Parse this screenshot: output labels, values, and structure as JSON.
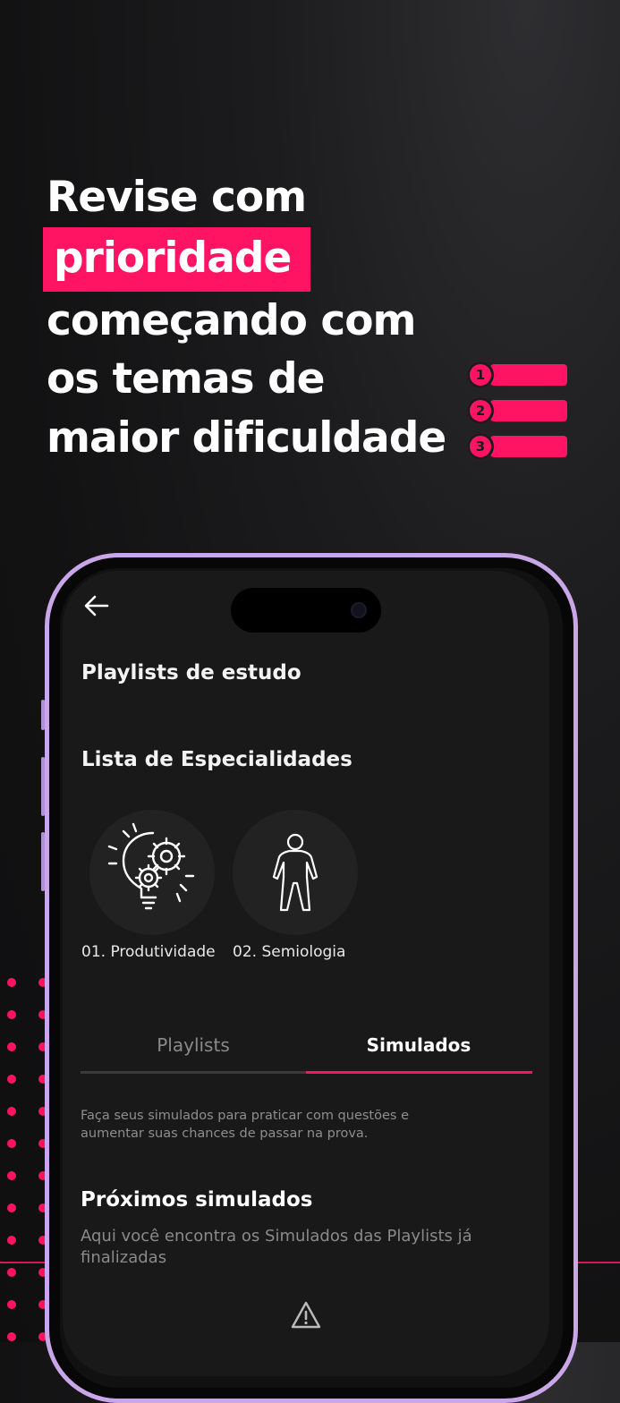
{
  "headline": {
    "line1": "Revise com",
    "highlight": "prioridade",
    "line3": "começando com",
    "line4": "os temas de",
    "line5": "maior dificuldade"
  },
  "ranking": [
    "1",
    "2",
    "3"
  ],
  "colors": {
    "accent": "#ff1464",
    "background": "#121213",
    "phone_frame": "#c9a6e8",
    "screen": "#191919"
  },
  "app": {
    "back_icon": "arrow-left-icon",
    "page_title": "Playlists de estudo",
    "section_title": "Lista de Especialidades",
    "specialties": [
      {
        "label": "01. Produtividade",
        "icon": "lightbulb-gears-icon"
      },
      {
        "label": "02. Semiologia",
        "icon": "human-body-icon"
      }
    ],
    "tabs": [
      {
        "label": "Playlists",
        "active": false
      },
      {
        "label": "Simulados",
        "active": true
      }
    ],
    "description": "Faça seus simulados para praticar com questões e aumentar suas chances de passar na prova.",
    "upcoming_title": "Próximos simulados",
    "upcoming_subtitle": "Aqui você encontra os Simulados das Playlists já finalizadas",
    "empty_icon": "warning-icon"
  }
}
